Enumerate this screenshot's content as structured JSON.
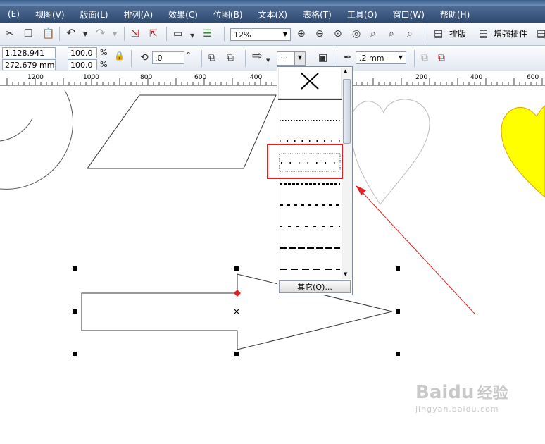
{
  "menu": [
    "(E)",
    "视图(V)",
    "版面(L)",
    "排列(A)",
    "效果(C)",
    "位图(B)",
    "文本(X)",
    "表格(T)",
    "工具(O)",
    "窗口(W)",
    "帮助(H)"
  ],
  "toolbar1": {
    "zoom": "12%",
    "layout_label": "排版",
    "plugin_label": "增强插件"
  },
  "toolbar2": {
    "pos_x": "1,128.941 mm",
    "pos_y": "272.679 mm",
    "scale_x": "100.0",
    "scale_y": "100.0",
    "percent": "%",
    "rotation": ".0",
    "degree": "°",
    "line_style": "· ·",
    "outline_width": ".2 mm"
  },
  "ruler": [
    "1200",
    "1000",
    "800",
    "600",
    "400",
    "200",
    "200",
    "400",
    "600"
  ],
  "dropdown": {
    "other_label": "其它(O)...",
    "styles": [
      "none",
      "dotted-fine",
      "dotted-sparse",
      "dotted-spaced",
      "dashed-short",
      "dashed",
      "dashed-spaced",
      "dashed-long",
      "dashed-longer"
    ]
  },
  "colors": {
    "heart_fill": "#ffff00",
    "heart_stroke": "#e0a000",
    "annotation": "#e02020"
  },
  "watermark": {
    "brand": "Baidu",
    "brand_cn": "经验",
    "url": "jingyan.baidu.com"
  }
}
